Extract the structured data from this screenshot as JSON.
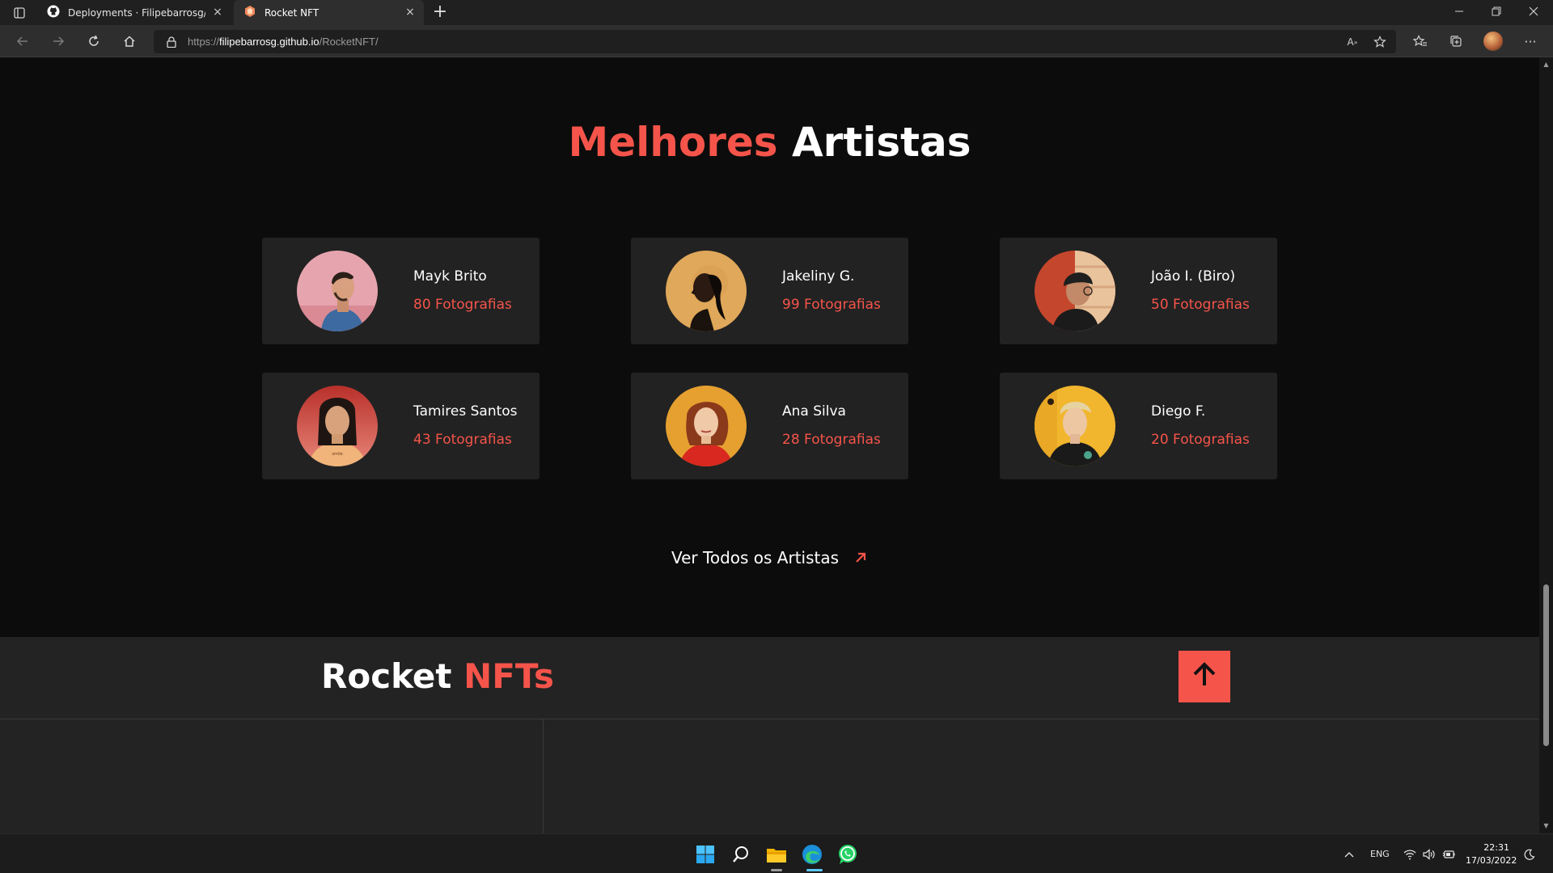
{
  "browser": {
    "tabs": [
      {
        "title": "Deployments · Filipebarrosg/Roc",
        "active": false,
        "icon": "github-icon"
      },
      {
        "title": "Rocket NFT",
        "active": true,
        "icon": "rocket-nft-icon"
      }
    ],
    "url_prefix": "https://",
    "url_host": "filipebarrosg.github.io",
    "url_path": "/RocketNFT/"
  },
  "section": {
    "title_accent": "Melhores",
    "title_plain": "Artistas"
  },
  "artists": [
    {
      "name": "Mayk Brito",
      "count": "80 Fotografias"
    },
    {
      "name": "Jakeliny G.",
      "count": "99 Fotografias"
    },
    {
      "name": "João I. (Biro)",
      "count": "50 Fotografias"
    },
    {
      "name": "Tamires Santos",
      "count": "43 Fotografias"
    },
    {
      "name": "Ana Silva",
      "count": "28 Fotografias"
    },
    {
      "name": "Diego F.",
      "count": "20 Fotografias"
    }
  ],
  "see_all": "Ver Todos os Artistas",
  "footer": {
    "logo_plain": "Rocket",
    "logo_accent": "NFTs"
  },
  "taskbar": {
    "lang": "ENG",
    "time": "22:31",
    "date": "17/03/2022"
  },
  "colors": {
    "accent": "#f5544a",
    "page_bg": "#0c0c0c",
    "card_bg": "#222222"
  }
}
